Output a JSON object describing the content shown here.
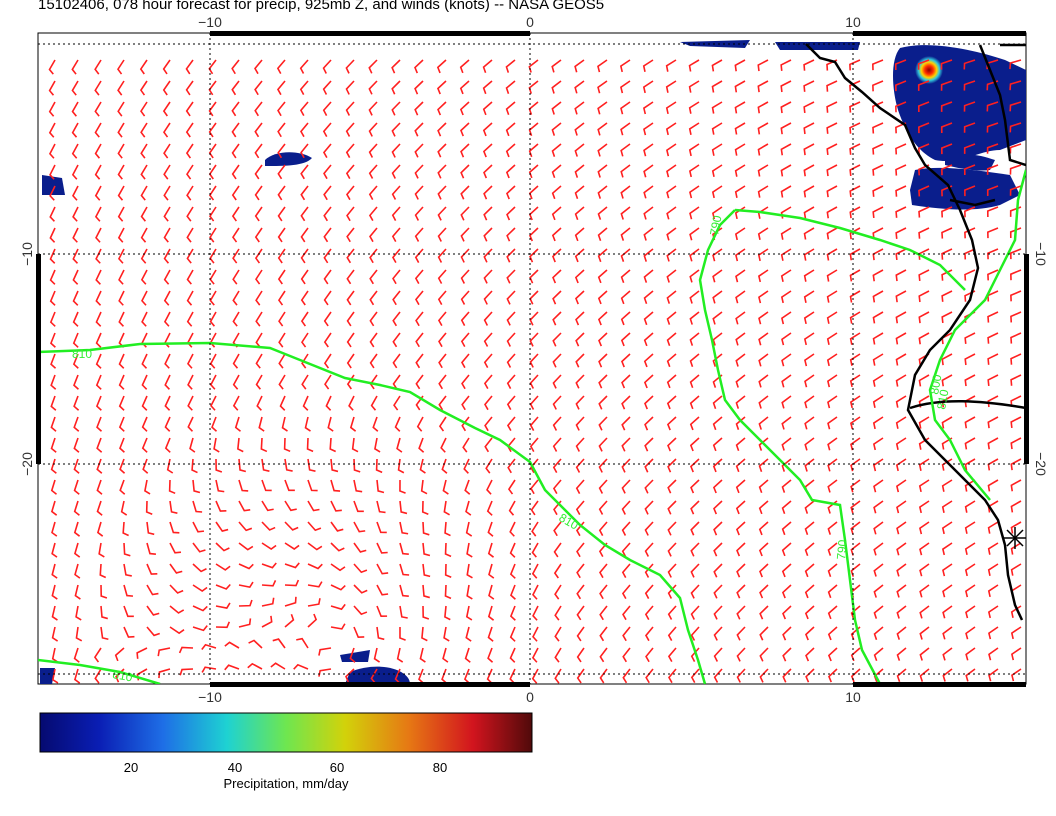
{
  "title": "15102406, 078 hour forecast for precip, 925mb Z, and winds (knots) -- NASA GEOS5",
  "map": {
    "lon_ticks": [
      -10,
      0,
      10
    ],
    "lon_tick_labels": [
      "−10",
      "0",
      "10"
    ],
    "lat_ticks": [
      -10,
      -20
    ],
    "lat_tick_labels": [
      "−10",
      "−20"
    ],
    "grid": "dotted",
    "colors": {
      "wind_barbs": "#ff2020",
      "geopotential_contours": "#22ee22",
      "coastline": "#000000",
      "precip_low": "#0a1e8c"
    },
    "contour_labels": [
      "810",
      "790",
      "810",
      "790",
      "810",
      "800",
      "810"
    ],
    "wind_field": "wind barbs (knots) on regular grid"
  },
  "colorbar": {
    "ticks": [
      20,
      40,
      60,
      80
    ],
    "title": "Precipitation, mm/day"
  }
}
